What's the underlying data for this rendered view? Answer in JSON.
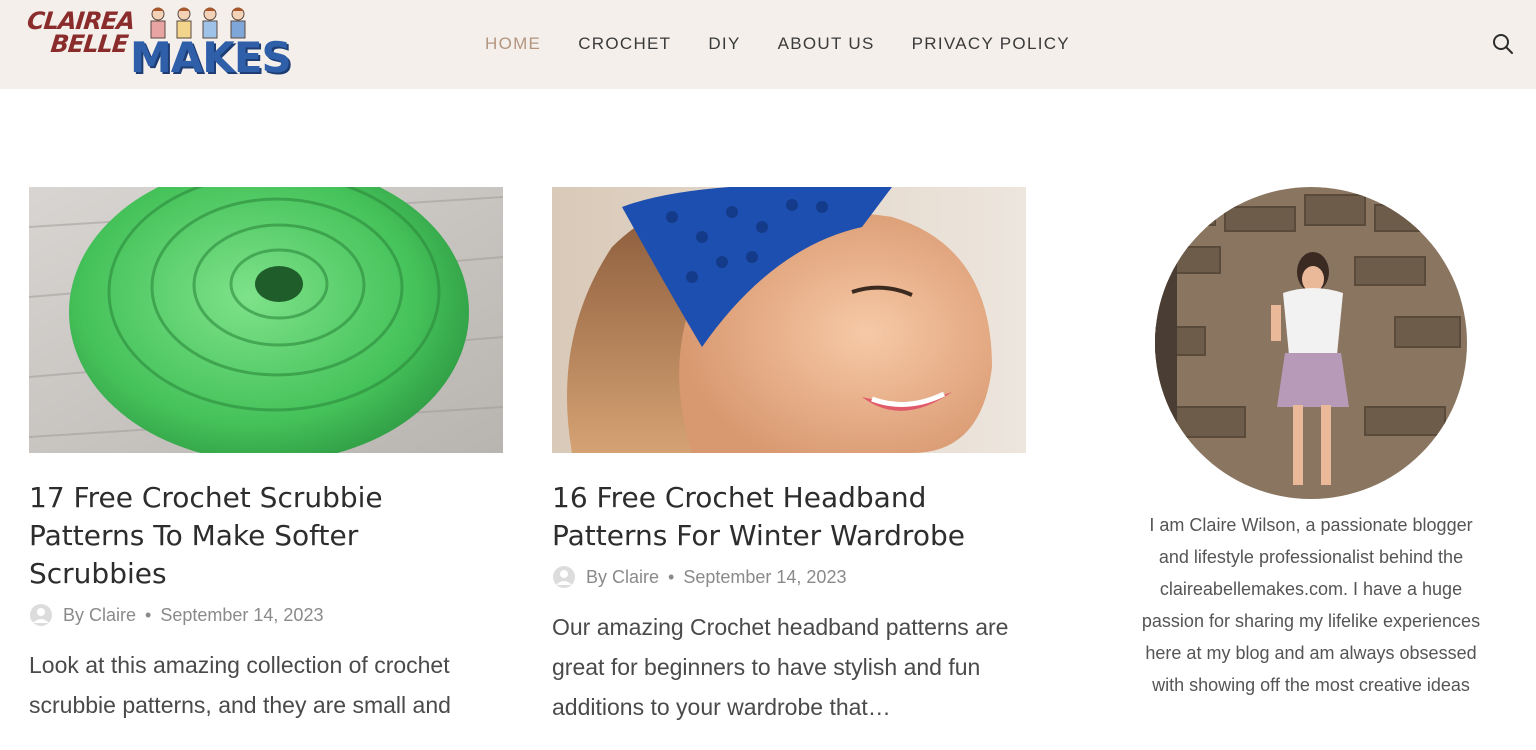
{
  "header": {
    "logo": {
      "line1": "CLAIREA",
      "line2": "BELLE",
      "line3": "MAKES"
    },
    "nav": [
      {
        "label": "HOME",
        "active": true
      },
      {
        "label": "CROCHET",
        "active": false
      },
      {
        "label": "DIY",
        "active": false
      },
      {
        "label": "ABOUT US",
        "active": false
      },
      {
        "label": "PRIVACY POLICY",
        "active": false
      }
    ],
    "search_icon": "search-icon"
  },
  "posts": [
    {
      "title": "17 Free Crochet Scrubbie Patterns To Make Softer Scrubbies",
      "author": "By Claire",
      "separator": "•",
      "date": "September 14, 2023",
      "excerpt": "Look at this amazing collection of crochet scrubbie patterns, and they are small and",
      "image": "green-crochet-scrubbie"
    },
    {
      "title": "16 Free Crochet Headband Patterns For Winter Wardrobe",
      "author": "By Claire",
      "separator": "•",
      "date": "September 14, 2023",
      "excerpt": "Our amazing Crochet headband patterns are great for beginners to have stylish and fun additions to your wardrobe that…",
      "image": "woman-blue-headband"
    }
  ],
  "sidebar": {
    "bio": "I am Claire Wilson, a passionate blogger and lifestyle professionalist behind the claireabellemakes.com. I have a huge passion for sharing my lifelike experiences here at my blog and am always obsessed with showing off the most creative ideas",
    "image": "profile-photo"
  },
  "colors": {
    "header_bg": "#f4efea",
    "nav_active": "#b39580",
    "logo_red": "#8b2c2c",
    "logo_blue": "#2f5fa8"
  }
}
